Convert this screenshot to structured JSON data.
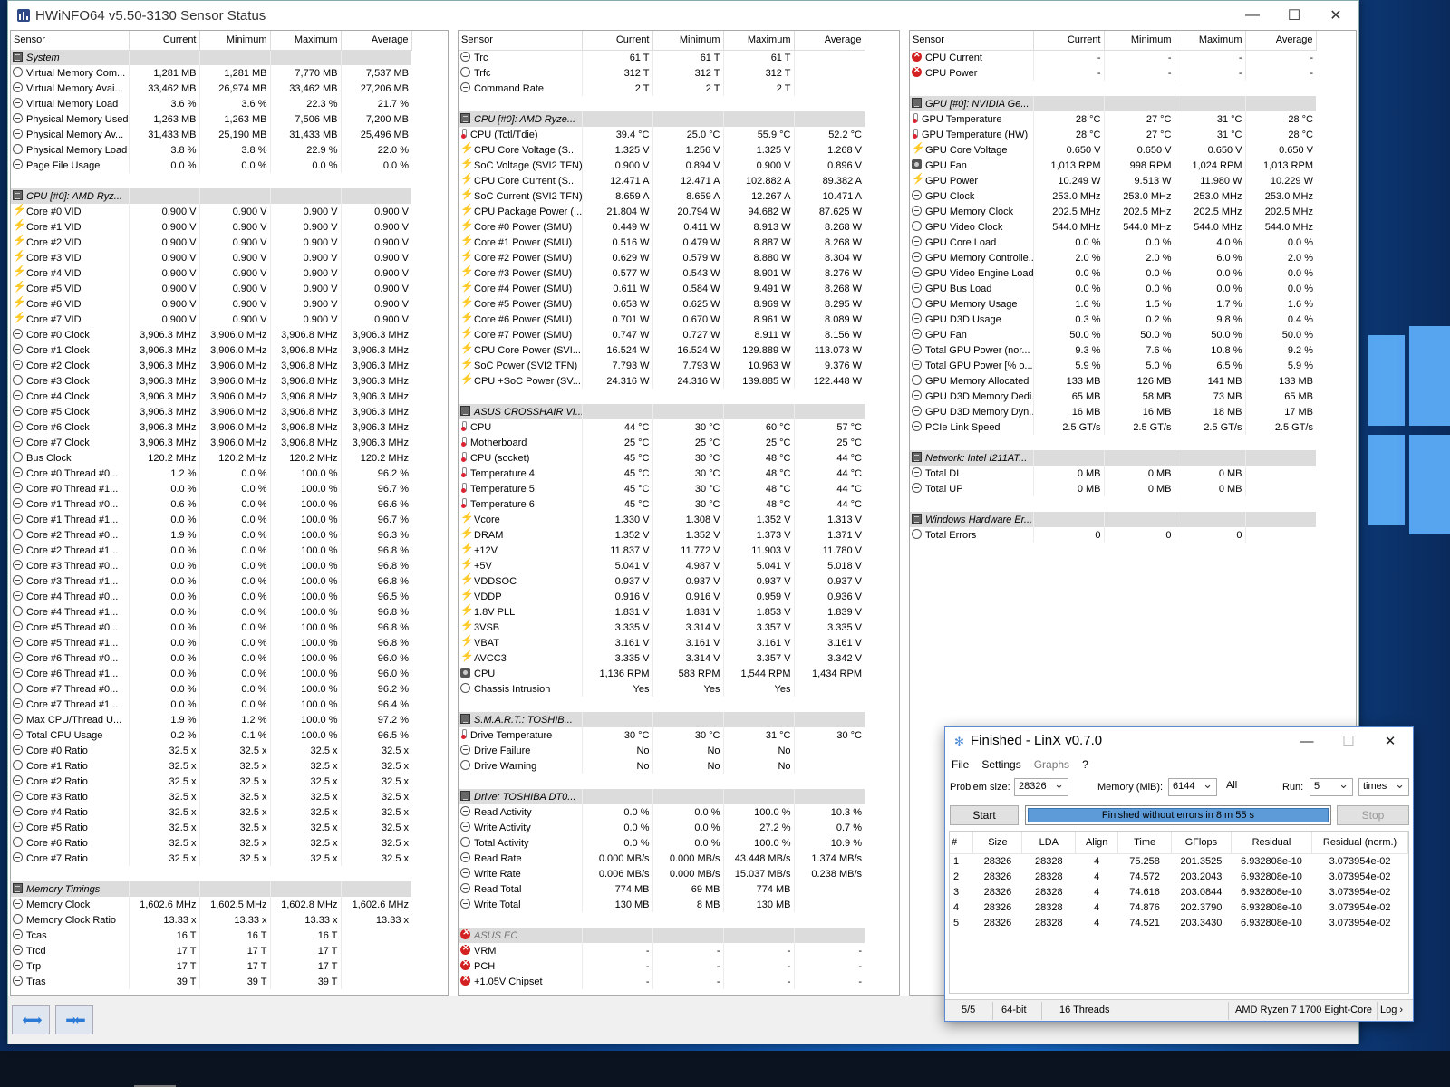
{
  "desktop": {
    "accent": "#0b3f86"
  },
  "hwinfo": {
    "title": "HWiNFO64 v5.50-3130 Sensor Status",
    "columns": [
      "Sensor",
      "Current",
      "Minimum",
      "Maximum",
      "Average"
    ],
    "panel1": [
      [
        "g",
        "System"
      ],
      [
        "c",
        "Virtual Memory Com...",
        "1,281 MB",
        "1,281 MB",
        "7,770 MB",
        "7,537 MB"
      ],
      [
        "c",
        "Virtual Memory Avai...",
        "33,462 MB",
        "26,974 MB",
        "33,462 MB",
        "27,206 MB"
      ],
      [
        "c",
        "Virtual Memory Load",
        "3.6 %",
        "3.6 %",
        "22.3 %",
        "21.7 %"
      ],
      [
        "c",
        "Physical Memory Used",
        "1,263 MB",
        "1,263 MB",
        "7,506 MB",
        "7,200 MB"
      ],
      [
        "c",
        "Physical Memory Av...",
        "31,433 MB",
        "25,190 MB",
        "31,433 MB",
        "25,496 MB"
      ],
      [
        "c",
        "Physical Memory Load",
        "3.8 %",
        "3.8 %",
        "22.9 %",
        "22.0 %"
      ],
      [
        "c",
        "Page File Usage",
        "0.0 %",
        "0.0 %",
        "0.0 %",
        "0.0 %"
      ],
      [
        "b"
      ],
      [
        "g",
        "CPU [#0]: AMD Ryz..."
      ],
      [
        "v",
        "Core #0 VID",
        "0.900 V",
        "0.900 V",
        "0.900 V",
        "0.900 V"
      ],
      [
        "v",
        "Core #1 VID",
        "0.900 V",
        "0.900 V",
        "0.900 V",
        "0.900 V"
      ],
      [
        "v",
        "Core #2 VID",
        "0.900 V",
        "0.900 V",
        "0.900 V",
        "0.900 V"
      ],
      [
        "v",
        "Core #3 VID",
        "0.900 V",
        "0.900 V",
        "0.900 V",
        "0.900 V"
      ],
      [
        "v",
        "Core #4 VID",
        "0.900 V",
        "0.900 V",
        "0.900 V",
        "0.900 V"
      ],
      [
        "v",
        "Core #5 VID",
        "0.900 V",
        "0.900 V",
        "0.900 V",
        "0.900 V"
      ],
      [
        "v",
        "Core #6 VID",
        "0.900 V",
        "0.900 V",
        "0.900 V",
        "0.900 V"
      ],
      [
        "v",
        "Core #7 VID",
        "0.900 V",
        "0.900 V",
        "0.900 V",
        "0.900 V"
      ],
      [
        "c",
        "Core #0 Clock",
        "3,906.3 MHz",
        "3,906.0 MHz",
        "3,906.8 MHz",
        "3,906.3 MHz"
      ],
      [
        "c",
        "Core #1 Clock",
        "3,906.3 MHz",
        "3,906.0 MHz",
        "3,906.8 MHz",
        "3,906.3 MHz"
      ],
      [
        "c",
        "Core #2 Clock",
        "3,906.3 MHz",
        "3,906.0 MHz",
        "3,906.8 MHz",
        "3,906.3 MHz"
      ],
      [
        "c",
        "Core #3 Clock",
        "3,906.3 MHz",
        "3,906.0 MHz",
        "3,906.8 MHz",
        "3,906.3 MHz"
      ],
      [
        "c",
        "Core #4 Clock",
        "3,906.3 MHz",
        "3,906.0 MHz",
        "3,906.8 MHz",
        "3,906.3 MHz"
      ],
      [
        "c",
        "Core #5 Clock",
        "3,906.3 MHz",
        "3,906.0 MHz",
        "3,906.8 MHz",
        "3,906.3 MHz"
      ],
      [
        "c",
        "Core #6 Clock",
        "3,906.3 MHz",
        "3,906.0 MHz",
        "3,906.8 MHz",
        "3,906.3 MHz"
      ],
      [
        "c",
        "Core #7 Clock",
        "3,906.3 MHz",
        "3,906.0 MHz",
        "3,906.8 MHz",
        "3,906.3 MHz"
      ],
      [
        "c",
        "Bus Clock",
        "120.2 MHz",
        "120.2 MHz",
        "120.2 MHz",
        "120.2 MHz"
      ],
      [
        "c",
        "Core #0 Thread #0...",
        "1.2 %",
        "0.0 %",
        "100.0 %",
        "96.2 %"
      ],
      [
        "c",
        "Core #0 Thread #1...",
        "0.0 %",
        "0.0 %",
        "100.0 %",
        "96.7 %"
      ],
      [
        "c",
        "Core #1 Thread #0...",
        "0.6 %",
        "0.0 %",
        "100.0 %",
        "96.6 %"
      ],
      [
        "c",
        "Core #1 Thread #1...",
        "0.0 %",
        "0.0 %",
        "100.0 %",
        "96.7 %"
      ],
      [
        "c",
        "Core #2 Thread #0...",
        "1.9 %",
        "0.0 %",
        "100.0 %",
        "96.3 %"
      ],
      [
        "c",
        "Core #2 Thread #1...",
        "0.0 %",
        "0.0 %",
        "100.0 %",
        "96.8 %"
      ],
      [
        "c",
        "Core #3 Thread #0...",
        "0.0 %",
        "0.0 %",
        "100.0 %",
        "96.8 %"
      ],
      [
        "c",
        "Core #3 Thread #1...",
        "0.0 %",
        "0.0 %",
        "100.0 %",
        "96.8 %"
      ],
      [
        "c",
        "Core #4 Thread #0...",
        "0.0 %",
        "0.0 %",
        "100.0 %",
        "96.5 %"
      ],
      [
        "c",
        "Core #4 Thread #1...",
        "0.0 %",
        "0.0 %",
        "100.0 %",
        "96.8 %"
      ],
      [
        "c",
        "Core #5 Thread #0...",
        "0.0 %",
        "0.0 %",
        "100.0 %",
        "96.8 %"
      ],
      [
        "c",
        "Core #5 Thread #1...",
        "0.0 %",
        "0.0 %",
        "100.0 %",
        "96.8 %"
      ],
      [
        "c",
        "Core #6 Thread #0...",
        "0.0 %",
        "0.0 %",
        "100.0 %",
        "96.0 %"
      ],
      [
        "c",
        "Core #6 Thread #1...",
        "0.0 %",
        "0.0 %",
        "100.0 %",
        "96.0 %"
      ],
      [
        "c",
        "Core #7 Thread #0...",
        "0.0 %",
        "0.0 %",
        "100.0 %",
        "96.2 %"
      ],
      [
        "c",
        "Core #7 Thread #1...",
        "0.0 %",
        "0.0 %",
        "100.0 %",
        "96.4 %"
      ],
      [
        "c",
        "Max CPU/Thread U...",
        "1.9 %",
        "1.2 %",
        "100.0 %",
        "97.2 %"
      ],
      [
        "c",
        "Total CPU Usage",
        "0.2 %",
        "0.1 %",
        "100.0 %",
        "96.5 %"
      ],
      [
        "c",
        "Core #0 Ratio",
        "32.5 x",
        "32.5 x",
        "32.5 x",
        "32.5 x"
      ],
      [
        "c",
        "Core #1 Ratio",
        "32.5 x",
        "32.5 x",
        "32.5 x",
        "32.5 x"
      ],
      [
        "c",
        "Core #2 Ratio",
        "32.5 x",
        "32.5 x",
        "32.5 x",
        "32.5 x"
      ],
      [
        "c",
        "Core #3 Ratio",
        "32.5 x",
        "32.5 x",
        "32.5 x",
        "32.5 x"
      ],
      [
        "c",
        "Core #4 Ratio",
        "32.5 x",
        "32.5 x",
        "32.5 x",
        "32.5 x"
      ],
      [
        "c",
        "Core #5 Ratio",
        "32.5 x",
        "32.5 x",
        "32.5 x",
        "32.5 x"
      ],
      [
        "c",
        "Core #6 Ratio",
        "32.5 x",
        "32.5 x",
        "32.5 x",
        "32.5 x"
      ],
      [
        "c",
        "Core #7 Ratio",
        "32.5 x",
        "32.5 x",
        "32.5 x",
        "32.5 x"
      ],
      [
        "b"
      ],
      [
        "g",
        "Memory Timings"
      ],
      [
        "c",
        "Memory Clock",
        "1,602.6 MHz",
        "1,602.5 MHz",
        "1,602.8 MHz",
        "1,602.6 MHz"
      ],
      [
        "c",
        "Memory Clock Ratio",
        "13.33 x",
        "13.33 x",
        "13.33 x",
        "13.33 x"
      ],
      [
        "c",
        "Tcas",
        "16 T",
        "16 T",
        "16 T",
        ""
      ],
      [
        "c",
        "Trcd",
        "17 T",
        "17 T",
        "17 T",
        ""
      ],
      [
        "c",
        "Trp",
        "17 T",
        "17 T",
        "17 T",
        ""
      ],
      [
        "c",
        "Tras",
        "39 T",
        "39 T",
        "39 T",
        ""
      ]
    ],
    "panel2": [
      [
        "c",
        "Trc",
        "61 T",
        "61 T",
        "61 T",
        ""
      ],
      [
        "c",
        "Trfc",
        "312 T",
        "312 T",
        "312 T",
        ""
      ],
      [
        "c",
        "Command Rate",
        "2 T",
        "2 T",
        "2 T",
        ""
      ],
      [
        "b"
      ],
      [
        "g",
        "CPU [#0]: AMD Ryze..."
      ],
      [
        "t",
        "CPU (Tctl/Tdie)",
        "39.4 °C",
        "25.0 °C",
        "55.9 °C",
        "52.2 °C"
      ],
      [
        "v",
        "CPU Core Voltage (S...",
        "1.325 V",
        "1.256 V",
        "1.325 V",
        "1.268 V"
      ],
      [
        "v",
        "SoC Voltage (SVI2 TFN)",
        "0.900 V",
        "0.894 V",
        "0.900 V",
        "0.896 V"
      ],
      [
        "v",
        "CPU Core Current (S...",
        "12.471 A",
        "12.471 A",
        "102.882 A",
        "89.382 A"
      ],
      [
        "v",
        "SoC Current (SVI2 TFN)",
        "8.659 A",
        "8.659 A",
        "12.267 A",
        "10.471 A"
      ],
      [
        "v",
        "CPU Package Power (...",
        "21.804 W",
        "20.794 W",
        "94.682 W",
        "87.625 W"
      ],
      [
        "v",
        "Core #0 Power (SMU)",
        "0.449 W",
        "0.411 W",
        "8.913 W",
        "8.268 W"
      ],
      [
        "v",
        "Core #1 Power (SMU)",
        "0.516 W",
        "0.479 W",
        "8.887 W",
        "8.268 W"
      ],
      [
        "v",
        "Core #2 Power (SMU)",
        "0.629 W",
        "0.579 W",
        "8.880 W",
        "8.304 W"
      ],
      [
        "v",
        "Core #3 Power (SMU)",
        "0.577 W",
        "0.543 W",
        "8.901 W",
        "8.276 W"
      ],
      [
        "v",
        "Core #4 Power (SMU)",
        "0.611 W",
        "0.584 W",
        "9.491 W",
        "8.268 W"
      ],
      [
        "v",
        "Core #5 Power (SMU)",
        "0.653 W",
        "0.625 W",
        "8.969 W",
        "8.295 W"
      ],
      [
        "v",
        "Core #6 Power (SMU)",
        "0.701 W",
        "0.670 W",
        "8.961 W",
        "8.089 W"
      ],
      [
        "v",
        "Core #7 Power (SMU)",
        "0.747 W",
        "0.727 W",
        "8.911 W",
        "8.156 W"
      ],
      [
        "v",
        "CPU Core Power (SVI...",
        "16.524 W",
        "16.524 W",
        "129.889 W",
        "113.073 W"
      ],
      [
        "v",
        "SoC Power (SVI2 TFN)",
        "7.793 W",
        "7.793 W",
        "10.963 W",
        "9.376 W"
      ],
      [
        "v",
        "CPU +SoC Power (SV...",
        "24.316 W",
        "24.316 W",
        "139.885 W",
        "122.448 W"
      ],
      [
        "b"
      ],
      [
        "g",
        "ASUS CROSSHAIR VI..."
      ],
      [
        "t",
        "CPU",
        "44 °C",
        "30 °C",
        "60 °C",
        "57 °C"
      ],
      [
        "t",
        "Motherboard",
        "25 °C",
        "25 °C",
        "25 °C",
        "25 °C"
      ],
      [
        "t",
        "CPU (socket)",
        "45 °C",
        "30 °C",
        "48 °C",
        "44 °C"
      ],
      [
        "t",
        "Temperature 4",
        "45 °C",
        "30 °C",
        "48 °C",
        "44 °C"
      ],
      [
        "t",
        "Temperature 5",
        "45 °C",
        "30 °C",
        "48 °C",
        "44 °C"
      ],
      [
        "t",
        "Temperature 6",
        "45 °C",
        "30 °C",
        "48 °C",
        "44 °C"
      ],
      [
        "v",
        "Vcore",
        "1.330 V",
        "1.308 V",
        "1.352 V",
        "1.313 V"
      ],
      [
        "v",
        "DRAM",
        "1.352 V",
        "1.352 V",
        "1.373 V",
        "1.371 V"
      ],
      [
        "v",
        "+12V",
        "11.837 V",
        "11.772 V",
        "11.903 V",
        "11.780 V"
      ],
      [
        "v",
        "+5V",
        "5.041 V",
        "4.987 V",
        "5.041 V",
        "5.018 V"
      ],
      [
        "v",
        "VDDSOC",
        "0.937 V",
        "0.937 V",
        "0.937 V",
        "0.937 V"
      ],
      [
        "v",
        "VDDP",
        "0.916 V",
        "0.916 V",
        "0.959 V",
        "0.936 V"
      ],
      [
        "v",
        "1.8V PLL",
        "1.831 V",
        "1.831 V",
        "1.853 V",
        "1.839 V"
      ],
      [
        "v",
        "3VSB",
        "3.335 V",
        "3.314 V",
        "3.357 V",
        "3.335 V"
      ],
      [
        "v",
        "VBAT",
        "3.161 V",
        "3.161 V",
        "3.161 V",
        "3.161 V"
      ],
      [
        "v",
        "AVCC3",
        "3.335 V",
        "3.314 V",
        "3.357 V",
        "3.342 V"
      ],
      [
        "f",
        "CPU",
        "1,136 RPM",
        "583 RPM",
        "1,544 RPM",
        "1,434 RPM"
      ],
      [
        "c",
        "Chassis Intrusion",
        "Yes",
        "Yes",
        "Yes",
        ""
      ],
      [
        "b"
      ],
      [
        "g",
        "S.M.A.R.T.: TOSHIB..."
      ],
      [
        "t",
        "Drive Temperature",
        "30 °C",
        "30 °C",
        "31 °C",
        "30 °C"
      ],
      [
        "c",
        "Drive Failure",
        "No",
        "No",
        "No",
        ""
      ],
      [
        "c",
        "Drive Warning",
        "No",
        "No",
        "No",
        ""
      ],
      [
        "b"
      ],
      [
        "g",
        "Drive: TOSHIBA DT0..."
      ],
      [
        "c",
        "Read Activity",
        "0.0 %",
        "0.0 %",
        "100.0 %",
        "10.3 %"
      ],
      [
        "c",
        "Write Activity",
        "0.0 %",
        "0.0 %",
        "27.2 %",
        "0.7 %"
      ],
      [
        "c",
        "Total Activity",
        "0.0 %",
        "0.0 %",
        "100.0 %",
        "10.9 %"
      ],
      [
        "c",
        "Read Rate",
        "0.000 MB/s",
        "0.000 MB/s",
        "43.448 MB/s",
        "1.374 MB/s"
      ],
      [
        "c",
        "Write Rate",
        "0.006 MB/s",
        "0.000 MB/s",
        "15.037 MB/s",
        "0.238 MB/s"
      ],
      [
        "c",
        "Read Total",
        "774 MB",
        "69 MB",
        "774 MB",
        ""
      ],
      [
        "c",
        "Write Total",
        "130 MB",
        "8 MB",
        "130 MB",
        ""
      ],
      [
        "b"
      ],
      [
        "ge",
        "ASUS EC"
      ],
      [
        "e",
        "VRM",
        "-",
        "-",
        "-",
        "-"
      ],
      [
        "e",
        "PCH",
        "-",
        "-",
        "-",
        "-"
      ],
      [
        "e",
        "+1.05V Chipset",
        "-",
        "-",
        "-",
        "-"
      ]
    ],
    "panel3": [
      [
        "e",
        "CPU Current",
        "-",
        "-",
        "-",
        "-"
      ],
      [
        "e",
        "CPU Power",
        "-",
        "-",
        "-",
        "-"
      ],
      [
        "b"
      ],
      [
        "g",
        "GPU [#0]: NVIDIA Ge..."
      ],
      [
        "t",
        "GPU Temperature",
        "28 °C",
        "27 °C",
        "31 °C",
        "28 °C"
      ],
      [
        "t",
        "GPU Temperature (HW)",
        "28 °C",
        "27 °C",
        "31 °C",
        "28 °C"
      ],
      [
        "v",
        "GPU Core Voltage",
        "0.650 V",
        "0.650 V",
        "0.650 V",
        "0.650 V"
      ],
      [
        "f",
        "GPU Fan",
        "1,013 RPM",
        "998 RPM",
        "1,024 RPM",
        "1,013 RPM"
      ],
      [
        "v",
        "GPU Power",
        "10.249 W",
        "9.513 W",
        "11.980 W",
        "10.229 W"
      ],
      [
        "c",
        "GPU Clock",
        "253.0 MHz",
        "253.0 MHz",
        "253.0 MHz",
        "253.0 MHz"
      ],
      [
        "c",
        "GPU Memory Clock",
        "202.5 MHz",
        "202.5 MHz",
        "202.5 MHz",
        "202.5 MHz"
      ],
      [
        "c",
        "GPU Video Clock",
        "544.0 MHz",
        "544.0 MHz",
        "544.0 MHz",
        "544.0 MHz"
      ],
      [
        "c",
        "GPU Core Load",
        "0.0 %",
        "0.0 %",
        "4.0 %",
        "0.0 %"
      ],
      [
        "c",
        "GPU Memory Controlle...",
        "2.0 %",
        "2.0 %",
        "6.0 %",
        "2.0 %"
      ],
      [
        "c",
        "GPU Video Engine Load",
        "0.0 %",
        "0.0 %",
        "0.0 %",
        "0.0 %"
      ],
      [
        "c",
        "GPU Bus Load",
        "0.0 %",
        "0.0 %",
        "0.0 %",
        "0.0 %"
      ],
      [
        "c",
        "GPU Memory Usage",
        "1.6 %",
        "1.5 %",
        "1.7 %",
        "1.6 %"
      ],
      [
        "c",
        "GPU D3D Usage",
        "0.3 %",
        "0.2 %",
        "9.8 %",
        "0.4 %"
      ],
      [
        "c",
        "GPU Fan",
        "50.0 %",
        "50.0 %",
        "50.0 %",
        "50.0 %"
      ],
      [
        "c",
        "Total GPU Power (nor...",
        "9.3 %",
        "7.6 %",
        "10.8 %",
        "9.2 %"
      ],
      [
        "c",
        "Total GPU Power [% o...",
        "5.9 %",
        "5.0 %",
        "6.5 %",
        "5.9 %"
      ],
      [
        "c",
        "GPU Memory Allocated",
        "133 MB",
        "126 MB",
        "141 MB",
        "133 MB"
      ],
      [
        "c",
        "GPU D3D Memory Dedi...",
        "65 MB",
        "58 MB",
        "73 MB",
        "65 MB"
      ],
      [
        "c",
        "GPU D3D Memory Dyn...",
        "16 MB",
        "16 MB",
        "18 MB",
        "17 MB"
      ],
      [
        "c",
        "PCIe Link Speed",
        "2.5 GT/s",
        "2.5 GT/s",
        "2.5 GT/s",
        "2.5 GT/s"
      ],
      [
        "b"
      ],
      [
        "g",
        "Network: Intel I211AT..."
      ],
      [
        "c",
        "Total DL",
        "0 MB",
        "0 MB",
        "0 MB",
        ""
      ],
      [
        "c",
        "Total UP",
        "0 MB",
        "0 MB",
        "0 MB",
        ""
      ],
      [
        "b"
      ],
      [
        "g",
        "Windows Hardware Er..."
      ],
      [
        "c",
        "Total Errors",
        "0",
        "0",
        "0",
        ""
      ]
    ]
  },
  "linx": {
    "title": "Finished - LinX v0.7.0",
    "menu": [
      "File",
      "Settings",
      "Graphs",
      "?"
    ],
    "problem_size_label": "Problem size:",
    "problem_size": "28326",
    "memory_label": "Memory (MiB):",
    "memory": "6144",
    "all_label": "All",
    "run_label": "Run:",
    "run": "5",
    "run_unit": "times",
    "start_label": "Start",
    "stop_label": "Stop",
    "progress_text": "Finished without errors in 8 m 55 s",
    "progress_fraction": 1.0,
    "columns": [
      "#",
      "Size",
      "LDA",
      "Align",
      "Time",
      "GFlops",
      "Residual",
      "Residual (norm.)"
    ],
    "rows": [
      [
        "1",
        "28326",
        "28328",
        "4",
        "75.258",
        "201.3525",
        "6.932808e-10",
        "3.073954e-02"
      ],
      [
        "2",
        "28326",
        "28328",
        "4",
        "74.572",
        "203.2043",
        "6.932808e-10",
        "3.073954e-02"
      ],
      [
        "3",
        "28326",
        "28328",
        "4",
        "74.616",
        "203.0844",
        "6.932808e-10",
        "3.073954e-02"
      ],
      [
        "4",
        "28326",
        "28328",
        "4",
        "74.876",
        "202.3790",
        "6.932808e-10",
        "3.073954e-02"
      ],
      [
        "5",
        "28326",
        "28328",
        "4",
        "74.521",
        "203.3430",
        "6.932808e-10",
        "3.073954e-02"
      ]
    ],
    "status": {
      "runs": "5/5",
      "bits": "64-bit",
      "threads": "16 Threads",
      "cpu": "AMD Ryzen 7 1700 Eight-Core",
      "log": "Log ›"
    }
  }
}
